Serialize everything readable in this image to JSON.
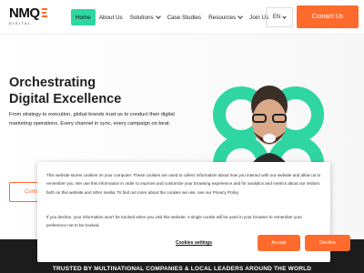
{
  "brand": {
    "name": "NMQ",
    "tagline": "DIGITAL"
  },
  "nav": {
    "items": [
      {
        "label": "Home",
        "active": true
      },
      {
        "label": "About Us"
      },
      {
        "label": "Solutions"
      },
      {
        "label": "Case Studies"
      },
      {
        "label": "Resources"
      },
      {
        "label": "Join Us"
      }
    ],
    "language": "EN",
    "contact_label": "Contact Us"
  },
  "hero": {
    "title": "Orchestrating Digital Excellence",
    "text": "From strategy to execution, global brands trust us to conduct their digital marketing operations. Every channel in sync, every campaign on beat.",
    "cta_label": "Contact Us"
  },
  "cookie_banner": {
    "paragraph1": "This website stores cookies on your computer. These cookies are used to collect information about how you interact with our website and allow us to remember you. We use this information in order to improve and customize your browsing experience and for analytics and metrics about our visitors both on this website and other media. To find out more about the cookies we use, see our Privacy Policy",
    "paragraph2": "If you decline, your information won't be tracked when you visit this website. A single cookie will be used in your browser to remember your preference not to be tracked.",
    "settings_label": "Cookies settings",
    "accept_label": "Accept",
    "decline_label": "Decline"
  },
  "trusted_banner": {
    "text": "TRUSTED BY MULTINATIONAL COMPANIES & LOCAL LEADERS AROUND THE WORLD"
  },
  "colors": {
    "accent": "#ff6b2c",
    "mint": "#2fd6a2",
    "dark": "#1c1c1c"
  }
}
